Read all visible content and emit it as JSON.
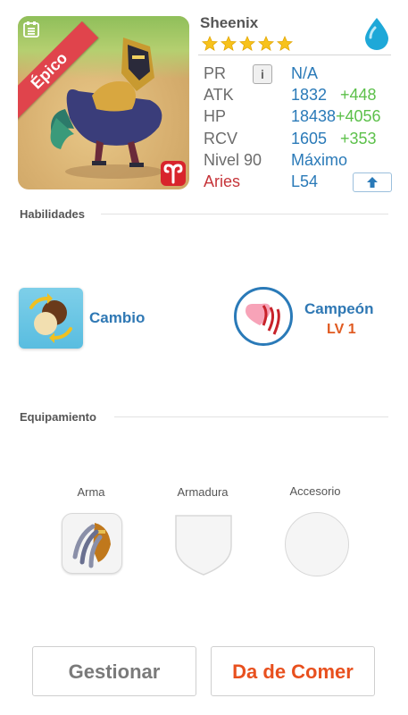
{
  "monster": {
    "name": "Sheenix",
    "rarity_label": "Épico",
    "stars": 5,
    "element_icon": "water-drop-icon",
    "zodiac_badge_icon": "aries-icon"
  },
  "stats": {
    "pr_label": "PR",
    "pr_value": "N/A",
    "atk_label": "ATK",
    "atk_value": "1832",
    "atk_bonus": "+448",
    "hp_label": "HP",
    "hp_value": "18438",
    "hp_bonus": "+4056",
    "rcv_label": "RCV",
    "rcv_value": "1605",
    "rcv_bonus": "+353",
    "level_label": "Nivel 90",
    "level_value": "Máximo",
    "sign_label": "Aries",
    "sign_value": "L54"
  },
  "skills": {
    "title": "Habilidades",
    "skill1": {
      "name": "Cambio"
    },
    "skill2": {
      "name": "Campeón",
      "level": "LV 1"
    }
  },
  "equipment": {
    "title": "Equipamiento",
    "slots": [
      {
        "label": "Arma"
      },
      {
        "label": "Armadura"
      },
      {
        "label": "Accesorio"
      }
    ]
  },
  "buttons": {
    "manage": "Gestionar",
    "feed": "Da de Comer"
  },
  "colors": {
    "accent_blue": "#2a7ab8",
    "bonus_green": "#5cc04a",
    "aries_red": "#c6353a",
    "feed_orange": "#e8501e",
    "rarity_ribbon": "#e0444c"
  }
}
